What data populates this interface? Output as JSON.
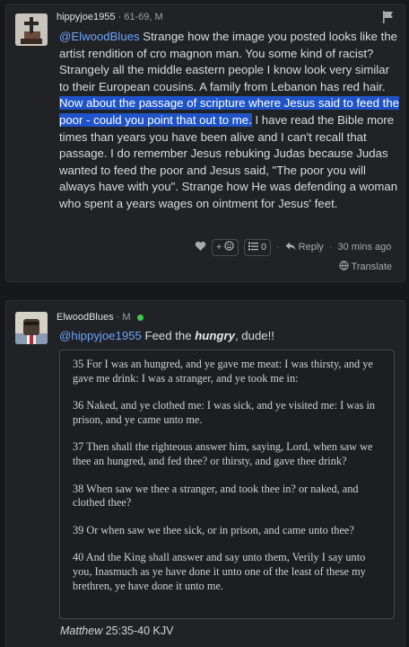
{
  "comment1": {
    "username": "hippyjoe1955",
    "user_info": "61-69, M",
    "mention": "@ElwoodBlues",
    "text_before": " Strange how the image you posted looks like the artist rendition of cro magnon man. You some kind of racist? Strangely all the middle eastern people I know look very similar to their European cousins. A family from Lebanon has red hair. ",
    "highlighted": "Now about the passage of scripture where Jesus said to feed the poor - could you point that out to me.",
    "text_after": " I have read the Bible more times than years you have been alive and I can't recall that passage. I do remember Jesus rebuking Judas because Judas wanted to feed the poor and Jesus said, \"The poor you will always have with you\". Strange how He was defending a woman who spent a years wages on ointment for Jesus' feet.",
    "reaction_add_label": "+",
    "replies_count": "0",
    "reply_label": "Reply",
    "timestamp": "30 mins ago",
    "translate_label": "Translate"
  },
  "comment2": {
    "username": "ElwoodBlues",
    "user_info": "M",
    "mention": "@hippyjoe1955",
    "text_pre": " Feed the ",
    "text_em": "hungry",
    "text_post": ", dude!!",
    "verses": [
      "35 For I was an hungred, and ye gave me meat: I was thirsty, and ye gave me drink: I was a stranger, and ye took me in:",
      "36 Naked, and ye clothed me: I was sick, and ye visited me: I was in prison, and ye came unto me.",
      "37 Then shall the righteous answer him, saying, Lord, when saw we thee an hungred, and fed thee? or thirsty, and gave thee drink?",
      "38 When saw we thee a stranger, and took thee in? or naked, and clothed thee?",
      "39 Or when saw we thee sick, or in prison, and came unto thee?",
      "40 And the King shall answer and say unto them, Verily I say unto you, Inasmuch as ye have done it unto one of the least of these my brethren, ye have done it unto me."
    ],
    "citation_book": "Matthew",
    "citation_ref": " 25:35-40 KJV"
  },
  "colors": {
    "background": "#16181b",
    "card": "#202225",
    "highlight": "#1e54c8",
    "mention": "#6ca5ff",
    "online": "#3fc84a"
  }
}
